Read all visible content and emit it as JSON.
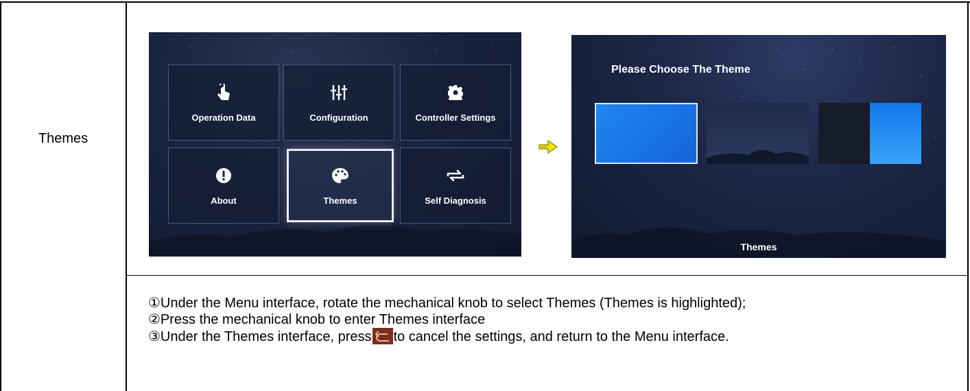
{
  "row_label": "Themes",
  "menu_screen": {
    "tiles": [
      {
        "label": "Operation Data",
        "icon": "touch-hand-icon"
      },
      {
        "label": "Configuration",
        "icon": "sliders-icon"
      },
      {
        "label": "Controller Settings",
        "icon": "gear-icon"
      },
      {
        "label": "About",
        "icon": "exclamation-icon"
      },
      {
        "label": "Themes",
        "icon": "palette-icon",
        "selected": true
      },
      {
        "label": "Self Diagnosis",
        "icon": "swap-arrows-icon"
      }
    ]
  },
  "arrow_icon": "right-arrow-icon",
  "themes_screen": {
    "title": "Please Choose The Theme",
    "footer": "Themes",
    "thumbnails": [
      "blue",
      "night-sky-mountain",
      "dark-and-blue"
    ]
  },
  "steps": {
    "s1": "①Under the Menu interface, rotate the mechanical knob to select Themes (Themes is highlighted);",
    "s2": "②Press the mechanical knob to enter Themes interface",
    "s3_before": "③Under the Themes interface, press",
    "s3_icon": "back-return-icon",
    "s3_after": "to cancel the settings, and return to the Menu interface."
  },
  "colors": {
    "accent_blue": "#1f86f0",
    "arrow_yellow": "#f5e400",
    "back_button": "#7a2e1c"
  }
}
